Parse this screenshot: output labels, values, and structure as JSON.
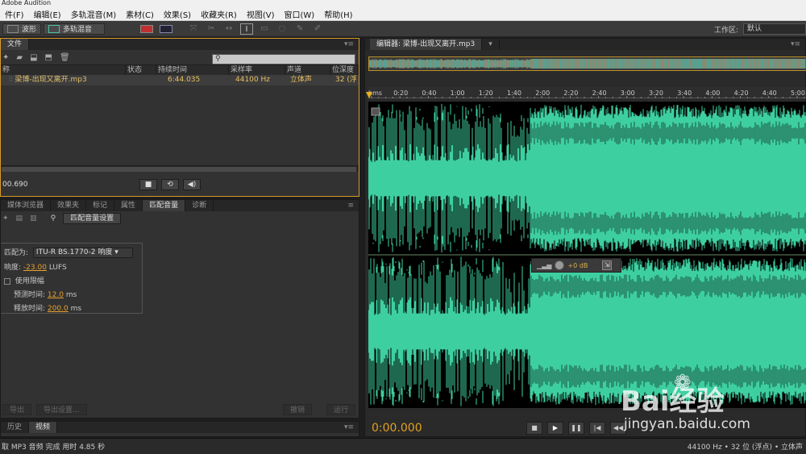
{
  "window": {
    "title": "Adobe Audition"
  },
  "menu": [
    "件(F)",
    "编辑(E)",
    "多轨混音(M)",
    "素材(C)",
    "效果(S)",
    "收藏夹(R)",
    "视图(V)",
    "窗口(W)",
    "帮助(H)"
  ],
  "toolbar": {
    "waveform_label": "波形",
    "multitrack_label": "多轨混音",
    "workspace_label": "工作区:",
    "workspace_value": "默认"
  },
  "files_panel": {
    "tab": "文件",
    "columns": [
      "称",
      "状态",
      "持续时间",
      "采样率",
      "声道",
      "位深度"
    ],
    "row": {
      "name": "梁博-出现又离开.mp3",
      "status": "",
      "duration": "6:44.035",
      "sample_rate": "44100 Hz",
      "channels": "立体声",
      "bit_depth": "32 (浮"
    },
    "selection_time": "00.690"
  },
  "lower_tabs": [
    "媒体浏览器",
    "效果夹",
    "标记",
    "属性",
    "匹配音量",
    "诊断"
  ],
  "match_panel": {
    "settings_button": "匹配音量设置",
    "match_to_label": "匹配为:",
    "match_to_value": "ITU-R BS.1770-2 响度",
    "loudness_label": "响度:",
    "loudness_value": "-23.00",
    "loudness_unit": "LUFS",
    "use_limit_label": "使用限幅",
    "lookahead_label": "预测时间:",
    "lookahead_value": "12.0",
    "lookahead_unit": "ms",
    "release_label": "释放时间:",
    "release_value": "200.0",
    "release_unit": "ms",
    "export_label": "导出",
    "export_settings_label": "导出设置...",
    "cancel_label": "撤销",
    "run_label": "运行"
  },
  "bottom_tabs": [
    "历史",
    "视频"
  ],
  "editor": {
    "tab": "编辑器: 梁博-出现又离开.mp3",
    "ruler_labels": [
      "hms",
      "0:20",
      "0:40",
      "1:00",
      "1:20",
      "1:40",
      "2:00",
      "2:20",
      "2:40",
      "3:00",
      "3:20",
      "3:40",
      "4:00",
      "4:20",
      "4:40",
      "5:00"
    ],
    "hud_gain": "+0 dB",
    "timecode": "0:00.000",
    "waveform_color": "#3ecfa0"
  },
  "status": {
    "left": "取 MP3 音频 完成 用时 4.85 秒",
    "right": "44100 Hz • 32 位 (浮点) • 立体声"
  },
  "watermark": {
    "logo": "Bai经验",
    "url": "jingyan.baidu.com"
  }
}
